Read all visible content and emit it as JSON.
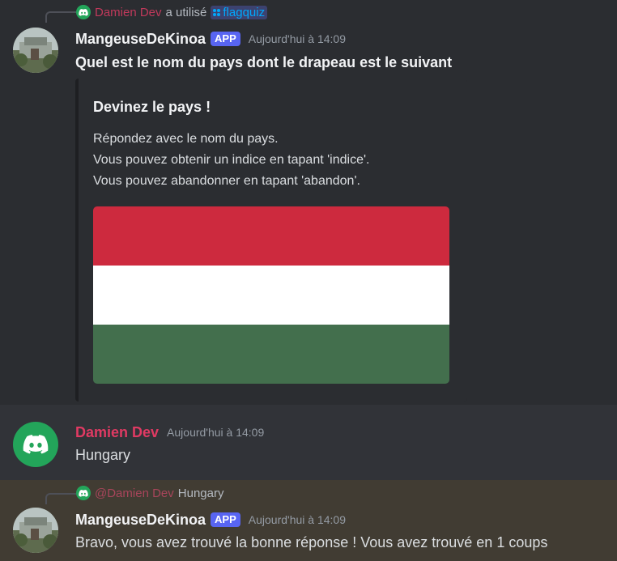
{
  "message1": {
    "reply": {
      "user": "Damien Dev",
      "action": "a utilisé",
      "command": "flagquiz"
    },
    "author": "MangeuseDeKinoa",
    "badge": "APP",
    "timestamp": "Aujourd'hui à 14:09",
    "content": "Quel est le nom du pays dont le drapeau est le suivant",
    "embed": {
      "title": "Devinez le pays !",
      "lines": [
        "Répondez avec le nom du pays.",
        "Vous pouvez obtenir un indice en tapant 'indice'.",
        "Vous pouvez abandonner en tapant 'abandon'."
      ],
      "flag_colors": [
        "#cd2a3e",
        "#ffffff",
        "#436f4d"
      ]
    }
  },
  "message2": {
    "author": "Damien Dev",
    "timestamp": "Aujourd'hui à 14:09",
    "content": "Hungary"
  },
  "message3": {
    "reply": {
      "user": "@Damien Dev",
      "content": "Hungary"
    },
    "author": "MangeuseDeKinoa",
    "badge": "APP",
    "timestamp": "Aujourd'hui à 14:09",
    "content": "Bravo, vous avez trouvé la bonne réponse ! Vous avez trouvé en 1 coups"
  },
  "colors": {
    "bg": "#313338",
    "bot_bg": "#2b2d31",
    "highlight_bg": "#413c33",
    "damien_color": "#e03a63",
    "command_color": "#00a8fc",
    "badge_color": "#5865f2",
    "discord_green": "#23a55a"
  }
}
